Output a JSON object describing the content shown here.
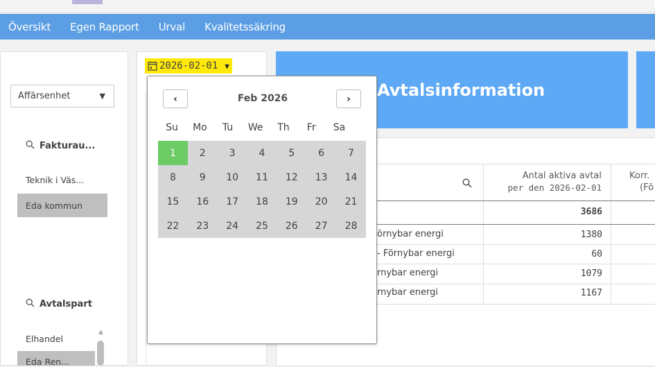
{
  "nav": {
    "items": [
      "Översikt",
      "Egen Rapport",
      "Urval",
      "Kvalitetssäkring"
    ],
    "color": "#5b9ee3"
  },
  "filters": {
    "dropdown_label": "Affärsenhet",
    "faktura_title": "Fakturau...",
    "faktura_items": [
      "Teknik i Väs...",
      "Eda kommun"
    ],
    "avtalspart_title": "Avtalspart",
    "avtalspart_items": [
      "Elhandel",
      "Eda Ren..."
    ]
  },
  "datepicker": {
    "value": "2026-02-01",
    "month_label": "Feb 2026",
    "prev_label": "‹",
    "next_label": "›",
    "weekdays": [
      "Su",
      "Mo",
      "Tu",
      "We",
      "Th",
      "Fr",
      "Sa"
    ],
    "days": [
      [
        "1",
        "2",
        "3",
        "4",
        "5",
        "6",
        "7"
      ],
      [
        "8",
        "9",
        "10",
        "11",
        "12",
        "13",
        "14"
      ],
      [
        "15",
        "16",
        "17",
        "18",
        "19",
        "20",
        "21"
      ],
      [
        "22",
        "23",
        "24",
        "25",
        "26",
        "27",
        "28"
      ]
    ],
    "selected_day": "1",
    "highlight_color": "#ffe90a",
    "selected_color": "#6ccb64"
  },
  "banner": {
    "title": "Avtalsinformation",
    "color": "#5ea9f5"
  },
  "table": {
    "header_line1": "Antal aktiva avtal",
    "header_line2": "per den 2026-02-01",
    "header_next_1": "Korr.",
    "header_next_2": "(Fö",
    "total": "3686",
    "rows": [
      {
        "label": "örnybar energi",
        "value": "1380"
      },
      {
        "label": "- Förnybar energi",
        "value": "60"
      },
      {
        "label": "rnybar energi",
        "value": "1079"
      },
      {
        "label": "rnybar energi",
        "value": "1167"
      }
    ]
  }
}
